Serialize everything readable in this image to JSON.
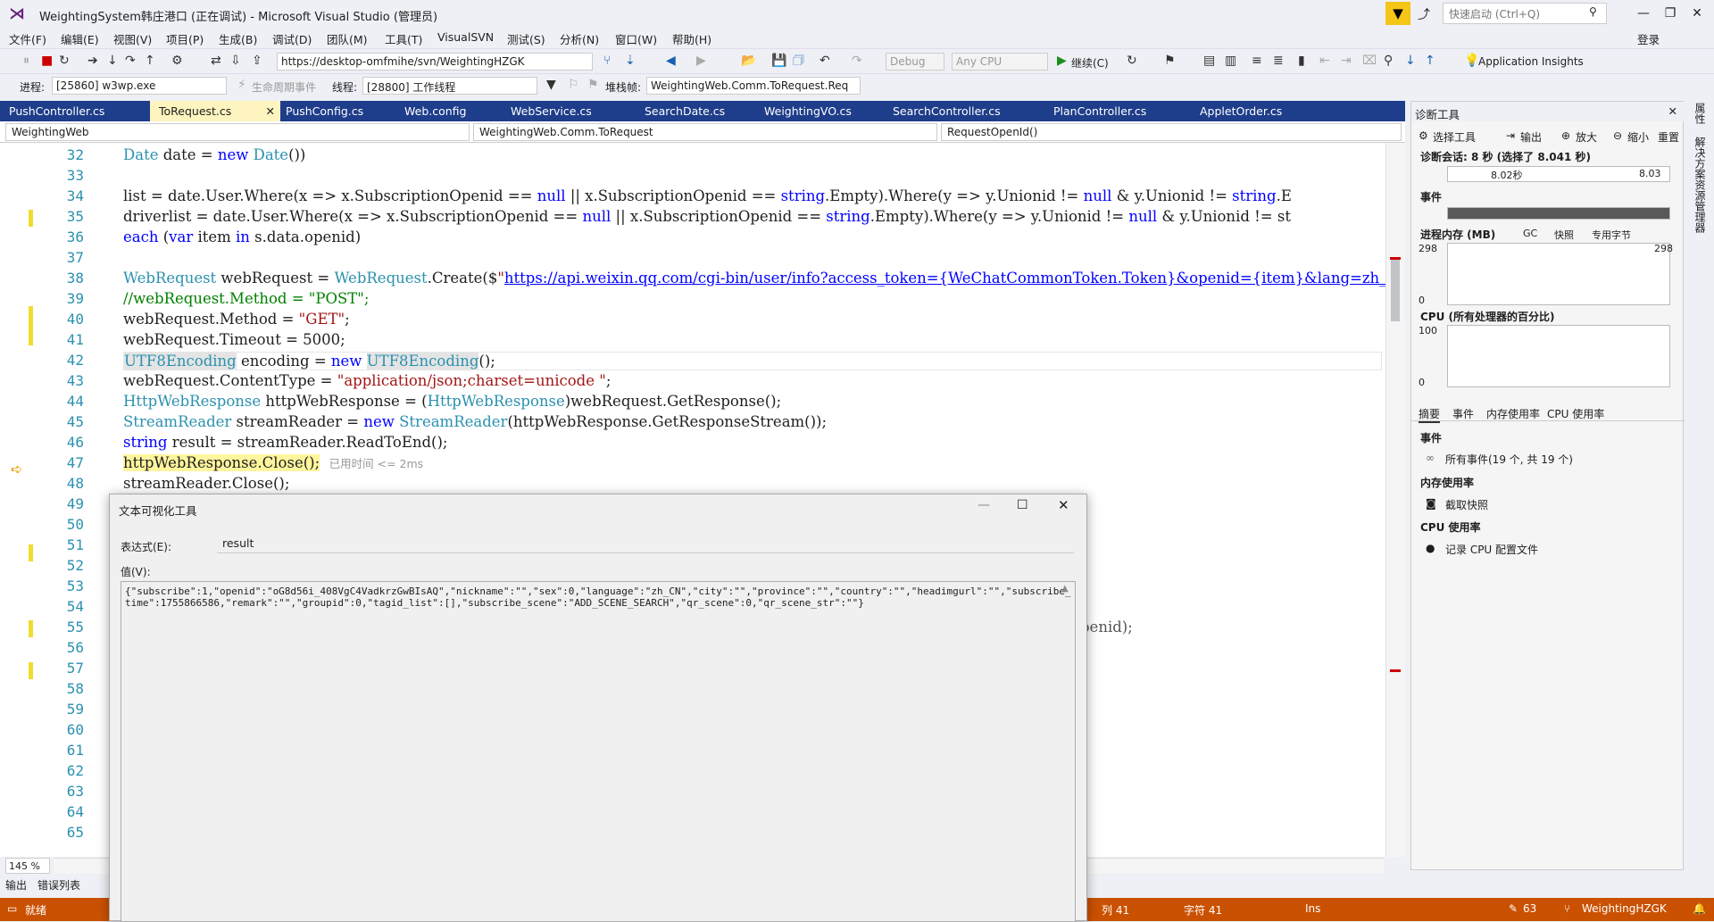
{
  "window": {
    "title": "WeightingSystem韩庄港口 (正在调试) - Microsoft Visual Studio (管理员)",
    "quick_launch": "快速启动 (Ctrl+Q)",
    "login": "登录"
  },
  "menu": [
    "文件(F)",
    "编辑(E)",
    "视图(V)",
    "项目(P)",
    "生成(B)",
    "调试(D)",
    "团队(M)",
    "工具(T)",
    "VisualSVN",
    "测试(S)",
    "分析(N)",
    "窗口(W)",
    "帮助(H)"
  ],
  "toolbar": {
    "svn_url": "https://desktop-omfmihe/svn/WeightingHZGK",
    "config": "Debug",
    "platform": "Any CPU",
    "continue": "继续(C)",
    "app_insights": "Application Insights",
    "process_label": "进程:",
    "process": "[25860] w3wp.exe",
    "lifecycle": "生命周期事件",
    "thread_label": "线程:",
    "thread": "[28800] 工作线程",
    "stack_label": "堆栈帧:",
    "stack": "WeightingWeb.Comm.ToRequest.Req"
  },
  "tabs": [
    "PushController.cs",
    "ToRequest.cs",
    "PushConfig.cs",
    "Web.config",
    "WebService.cs",
    "SearchDate.cs",
    "WeightingVO.cs",
    "SearchController.cs",
    "PlanController.cs",
    "AppletOrder.cs"
  ],
  "nav": {
    "project": "WeightingWeb",
    "class": "WeightingWeb.Comm.ToRequest",
    "member": "RequestOpenId()"
  },
  "editor": {
    "zoom": "145 %",
    "lines": [
      "32",
      "33",
      "34",
      "35",
      "36",
      "37",
      "38",
      "39",
      "40",
      "41",
      "42",
      "43",
      "44",
      "45",
      "46",
      "47",
      "48",
      "49",
      "50",
      "51",
      "52",
      "53",
      "54",
      "55",
      "56",
      "57",
      "58",
      "59",
      "60",
      "61",
      "62",
      "63",
      "64",
      "65"
    ],
    "elapsed": "已用时间 <= 2ms",
    "tail55": "penid);"
  },
  "visualizer": {
    "title": "文本可视化工具",
    "expr_label": "表达式(E):",
    "expr": "result",
    "value_label": "值(V):",
    "value": "{\"subscribe\":1,\"openid\":\"oG8d56i_408VgC4VadkrzGwBIsAQ\",\"nickname\":\"\",\"sex\":0,\"language\":\"zh_CN\",\"city\":\"\",\"province\":\"\",\"country\":\"\",\"headimgurl\":\"\",\"subscribe_time\":1755866586,\"remark\":\"\",\"groupid\":0,\"tagid_list\":[],\"subscribe_scene\":\"ADD_SCENE_SEARCH\",\"qr_scene\":0,\"qr_scene_str\":\"\"}"
  },
  "diag": {
    "title": "诊断工具",
    "select_tool": "选择工具",
    "output": "输出",
    "zoom_in": "放大",
    "zoom_out": "缩小",
    "reset": "重置",
    "session": "诊断会话: 8 秒 (选择了 8.041 秒)",
    "t1": "8.02秒",
    "t2": "8.03",
    "events": "事件",
    "memory": "进程内存 (MB)",
    "gc": "GC",
    "snapshot": "快照",
    "private": "专用字节",
    "mem_max": "298",
    "mem_min": "0",
    "cpu": "CPU (所有处理器的百分比)",
    "cpu_max": "100",
    "cpu_min": "0",
    "subtabs": [
      "摘要",
      "事件",
      "内存使用率",
      "CPU 使用率"
    ],
    "sec_events": "事件",
    "all_events": "所有事件(19 个, 共 19 个)",
    "sec_memory": "内存使用率",
    "take_snapshot": "截取快照",
    "sec_cpu": "CPU 使用率",
    "record_cpu": "记录 CPU 配置文件"
  },
  "right_strip": [
    "属性",
    "解决方案资源管理器"
  ],
  "bottom_tabs": [
    "输出",
    "错误列表"
  ],
  "status": {
    "ready": "就绪",
    "col": "列 41",
    "char": "字符 41",
    "ins": "Ins",
    "changes": "63",
    "branch": "WeightingHZGK"
  }
}
